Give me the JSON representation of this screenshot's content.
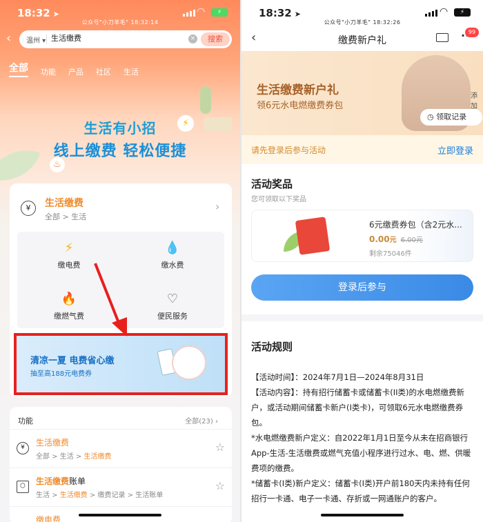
{
  "left": {
    "status": {
      "time": "18:32",
      "watermark": "公众号\"小刀羊毛\"   18:32:14",
      "battery": "⚡"
    },
    "search": {
      "city": "温州",
      "query": "生活缴费",
      "button": "搜索"
    },
    "tabs": [
      "全部",
      "功能",
      "产品",
      "社区",
      "生活"
    ],
    "hero": {
      "line1": "生活有小招",
      "line2": "线上缴费 轻松便捷"
    },
    "service_card": {
      "title": "生活缴费",
      "path": "全部 > 生活",
      "items": [
        {
          "label": "缴电费",
          "icon": "lightning-icon"
        },
        {
          "label": "缴水费",
          "icon": "water-drop-icon"
        },
        {
          "label": "缴燃气费",
          "icon": "flame-icon"
        },
        {
          "label": "便民服务",
          "icon": "heart-hands-icon"
        }
      ]
    },
    "banner": {
      "title": "清凉一夏 电费省心缴",
      "subtitle": "抽至高188元电费券"
    },
    "functions": {
      "header": "功能",
      "all": "全部(23)",
      "rows": [
        {
          "title": "生活缴费",
          "path_pre": "全部 > 生活 > ",
          "path_hl": "生活缴费",
          "path_post": ""
        },
        {
          "title_hl": "生活缴费",
          "title_rest": "账单",
          "path_pre": "生活 > ",
          "path_hl": "生活缴费",
          "path_post": " > 缴费记录 > 生活账单"
        },
        {
          "title": "缴电费"
        }
      ]
    },
    "colors": {
      "accent": "#f08a2a",
      "highlight_box": "#e8201c"
    }
  },
  "right": {
    "status": {
      "time": "18:32",
      "watermark": "公众号\"小刀羊毛\"   18:32:26"
    },
    "nav": {
      "title": "缴费新户礼",
      "badge": "99"
    },
    "hero": {
      "title": "生活缴费新户礼",
      "subtitle": "领6元水电燃缴费券包",
      "record_btn": "领取记录",
      "add": "添加"
    },
    "login_bar": {
      "text": "请先登录后参与活动",
      "action": "立即登录"
    },
    "prize": {
      "heading": "活动奖品",
      "sub": "您可领取以下奖品",
      "name": "6元缴费券包（含2元水...",
      "price": "0.00",
      "price_unit": "元",
      "orig": "6.00元",
      "remain": "剩余75046件",
      "join": "登录后参与"
    },
    "rules": {
      "heading": "活动规则",
      "lines": [
        "【活动时间】：2024年7月1日—2024年8月31日",
        "【活动内容】：持有招行储蓄卡或储蓄卡(II类)的水电燃缴费新户，或活动期间储蓄卡新户(I类卡)，可领取6元水电燃缴费券包。",
        "*水电燃缴费新户定义：自2022年1月1日至今从未在招商银行App-生活-生活缴费或燃气充值小程序进行过水、电、燃、供暖费项的缴费。",
        "*储蓄卡(I类)新户定义：储蓄卡(I类)开户前180天内未持有任何招行一卡通、电子一卡通、存折或一网通账户的客户。"
      ]
    },
    "colors": {
      "primary": "#3a8ae6",
      "warm": "#a6622a"
    }
  }
}
